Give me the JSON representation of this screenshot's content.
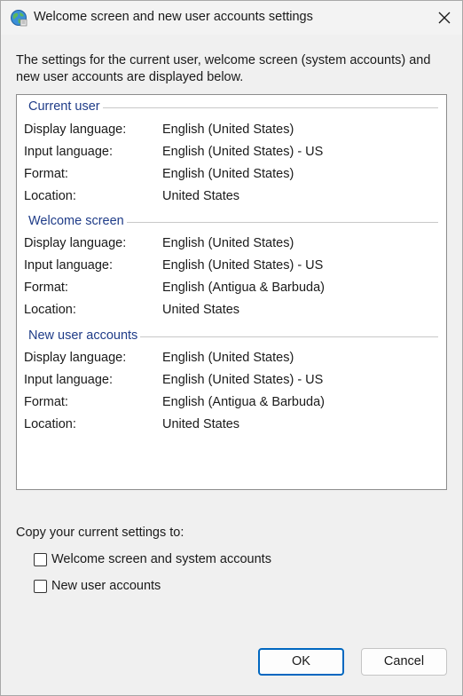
{
  "window": {
    "title": "Welcome screen and new user accounts settings",
    "icon": "globe-icon",
    "close_icon": "close-icon"
  },
  "intro_text": "The settings for the current user, welcome screen (system accounts) and new user accounts are displayed below.",
  "groups": [
    {
      "title": "Current user",
      "rows": [
        {
          "label": "Display language:",
          "value": "English (United States)"
        },
        {
          "label": "Input language:",
          "value": "English (United States) - US"
        },
        {
          "label": "Format:",
          "value": "English (United States)"
        },
        {
          "label": "Location:",
          "value": "United States"
        }
      ]
    },
    {
      "title": "Welcome screen",
      "rows": [
        {
          "label": "Display language:",
          "value": "English (United States)"
        },
        {
          "label": "Input language:",
          "value": "English (United States) - US"
        },
        {
          "label": "Format:",
          "value": "English (Antigua & Barbuda)"
        },
        {
          "label": "Location:",
          "value": "United States"
        }
      ]
    },
    {
      "title": "New user accounts",
      "rows": [
        {
          "label": "Display language:",
          "value": "English (United States)"
        },
        {
          "label": "Input language:",
          "value": "English (United States) - US"
        },
        {
          "label": "Format:",
          "value": "English (Antigua & Barbuda)"
        },
        {
          "label": "Location:",
          "value": "United States"
        }
      ]
    }
  ],
  "copy": {
    "label": "Copy your current settings to:",
    "options": [
      {
        "label": "Welcome screen and system accounts",
        "checked": false
      },
      {
        "label": "New user accounts",
        "checked": false
      }
    ]
  },
  "buttons": {
    "ok": "OK",
    "cancel": "Cancel"
  },
  "colors": {
    "group_title": "#1f3c88",
    "ok_border": "#0067c0",
    "background": "#f0f0f0"
  }
}
